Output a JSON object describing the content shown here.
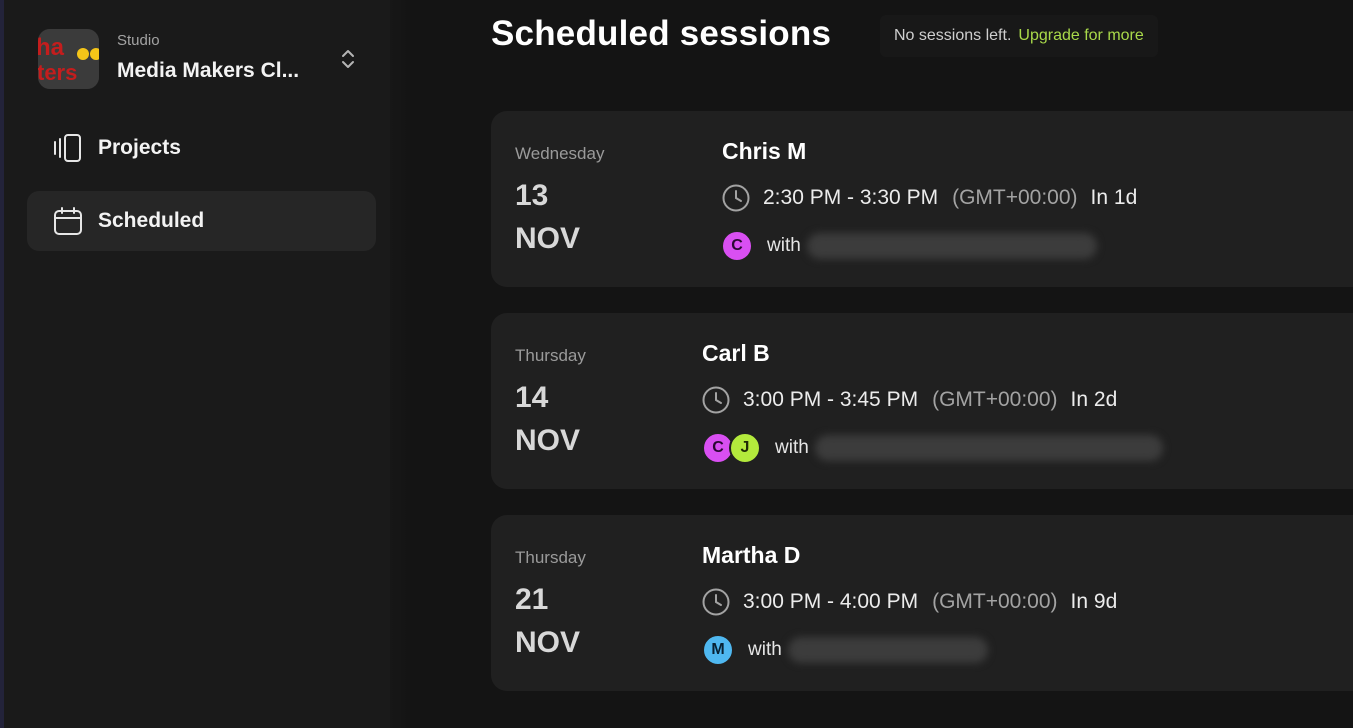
{
  "sidebar": {
    "studio": {
      "caption": "Studio",
      "name": "Media Makers Cl...",
      "logo_text_top": "ha",
      "logo_text_bottom": "ters"
    },
    "nav": [
      {
        "label": "Projects",
        "icon": "projects-icon",
        "active": false
      },
      {
        "label": "Scheduled",
        "icon": "calendar-icon",
        "active": true
      }
    ]
  },
  "main": {
    "title": "Scheduled sessions",
    "notice": {
      "message": "No sessions left.",
      "link": "Upgrade for more"
    }
  },
  "sessions": [
    {
      "weekday": "Wednesday",
      "day": "13",
      "month": "NOV",
      "name": "Chris M",
      "time": "2:30 PM - 3:30 PM",
      "timezone": "(GMT+00:00)",
      "relative": "In 1d",
      "avatars": [
        {
          "letter": "C",
          "color": "#d94ff2"
        }
      ],
      "with": "with"
    },
    {
      "weekday": "Thursday",
      "day": "14",
      "month": "NOV",
      "name": "Carl B",
      "time": "3:00 PM - 3:45 PM",
      "timezone": "(GMT+00:00)",
      "relative": "In 2d",
      "avatars": [
        {
          "letter": "C",
          "color": "#d94ff2"
        },
        {
          "letter": "J",
          "color": "#b3ea3c"
        }
      ],
      "with": "with"
    },
    {
      "weekday": "Thursday",
      "day": "21",
      "month": "NOV",
      "name": "Martha D",
      "time": "3:00 PM - 4:00 PM",
      "timezone": "(GMT+00:00)",
      "relative": "In 9d",
      "avatars": [
        {
          "letter": "M",
          "color": "#4fb8f0"
        }
      ],
      "with": "with"
    }
  ],
  "colors": {
    "accent": "#a9d94a",
    "background": "#141414",
    "sidebar": "#1a1a1a",
    "card": "#202020"
  }
}
